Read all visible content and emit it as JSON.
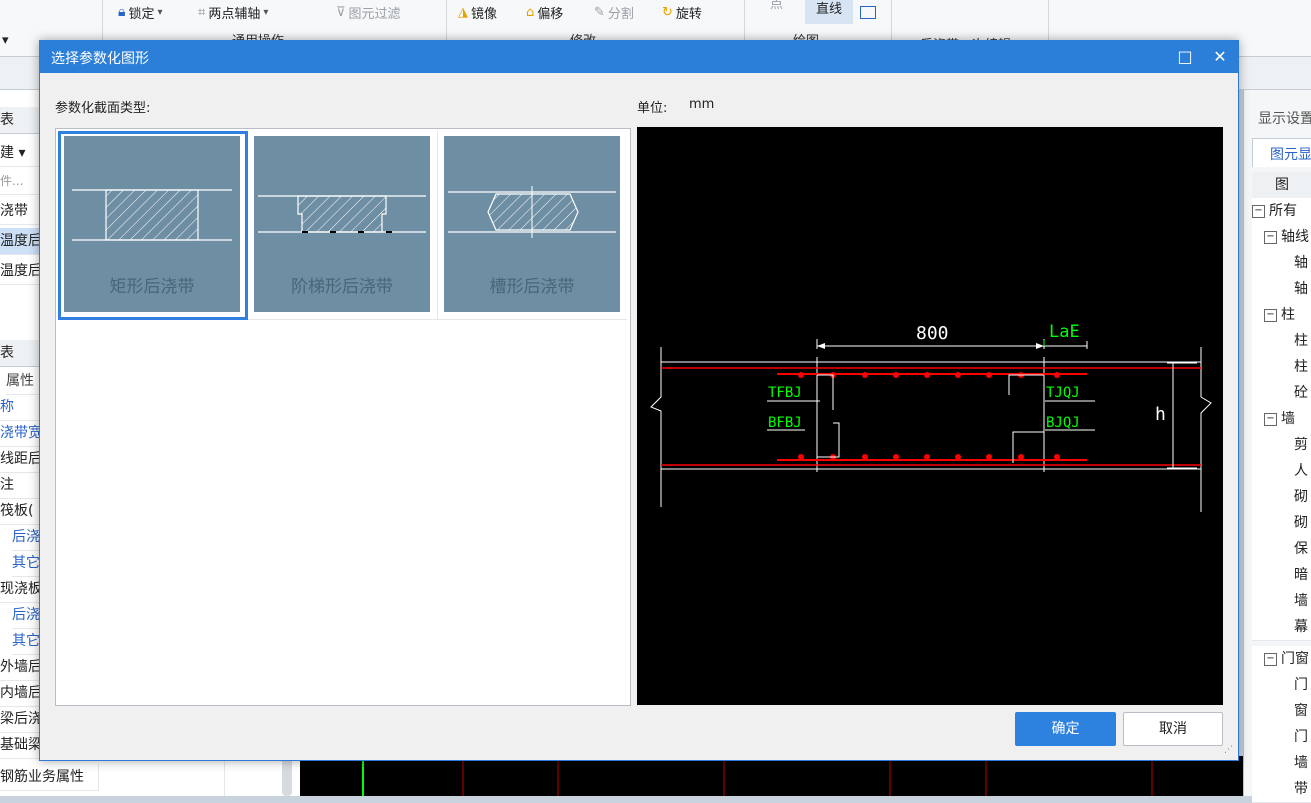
{
  "ribbon": {
    "left_dropdown": "▾",
    "lock": "锁定",
    "two_point_axis": "两点辅轴",
    "filter": "图元过滤",
    "mirror": "镜像",
    "offset": "偏移",
    "split": "分割",
    "rotate": "旋转",
    "point_partial": "点",
    "line_partial": "直线",
    "group_general": "通用操作",
    "group_modify": "修改",
    "group_draw": "绘图",
    "group_identify": "后浇带二次编辑"
  },
  "left_panel": {
    "tab1": "表",
    "new_label": "建 ▾",
    "search_placeholder": "件...",
    "tree1": [
      "浇带",
      "温度后",
      "温度后"
    ],
    "tab2": "表",
    "prop_header": "属性",
    "props": [
      "称",
      "浇带宽",
      "线距后",
      "注",
      "筏板(",
      "后浇",
      "其它",
      "现浇板",
      "后浇",
      "其它",
      "外墙后",
      "内墙后",
      "梁后浇",
      "基础梁"
    ],
    "bottom_row": "钢筋业务属性"
  },
  "right_panel": {
    "title": "显示设置",
    "tab": "图元显",
    "col_header": "图",
    "items": [
      "所有",
      "轴线",
      "轴",
      "轴",
      "柱",
      "柱",
      "柱",
      "砼",
      "墙",
      "剪",
      "人",
      "砌",
      "砌",
      "保",
      "暗",
      "墙",
      "幕",
      "门窗",
      "门",
      "窗",
      "门",
      "墙",
      "带"
    ]
  },
  "dialog": {
    "title": "选择参数化图形",
    "maximize": "□",
    "close": "✕",
    "section_type_label": "参数化截面类型:",
    "unit_label": "单位:",
    "unit_value": "mm",
    "shapes": [
      {
        "caption": "矩形后浇带",
        "selected": true
      },
      {
        "caption": "阶梯形后浇带",
        "selected": false
      },
      {
        "caption": "槽形后浇带",
        "selected": false
      }
    ],
    "preview": {
      "dim_width": "800",
      "dim_lae": "LaE",
      "tfbj": "TFBJ",
      "bfbj": "BFBJ",
      "tjqj": "TJQJ",
      "bjqj": "BJQJ",
      "h": "h"
    },
    "ok_label": "确定",
    "cancel_label": "取消"
  },
  "colors": {
    "accent": "#2b7fd8",
    "card_bg": "#6e8fa3",
    "rebar": "#ff0000",
    "labels": "#00ff00"
  }
}
